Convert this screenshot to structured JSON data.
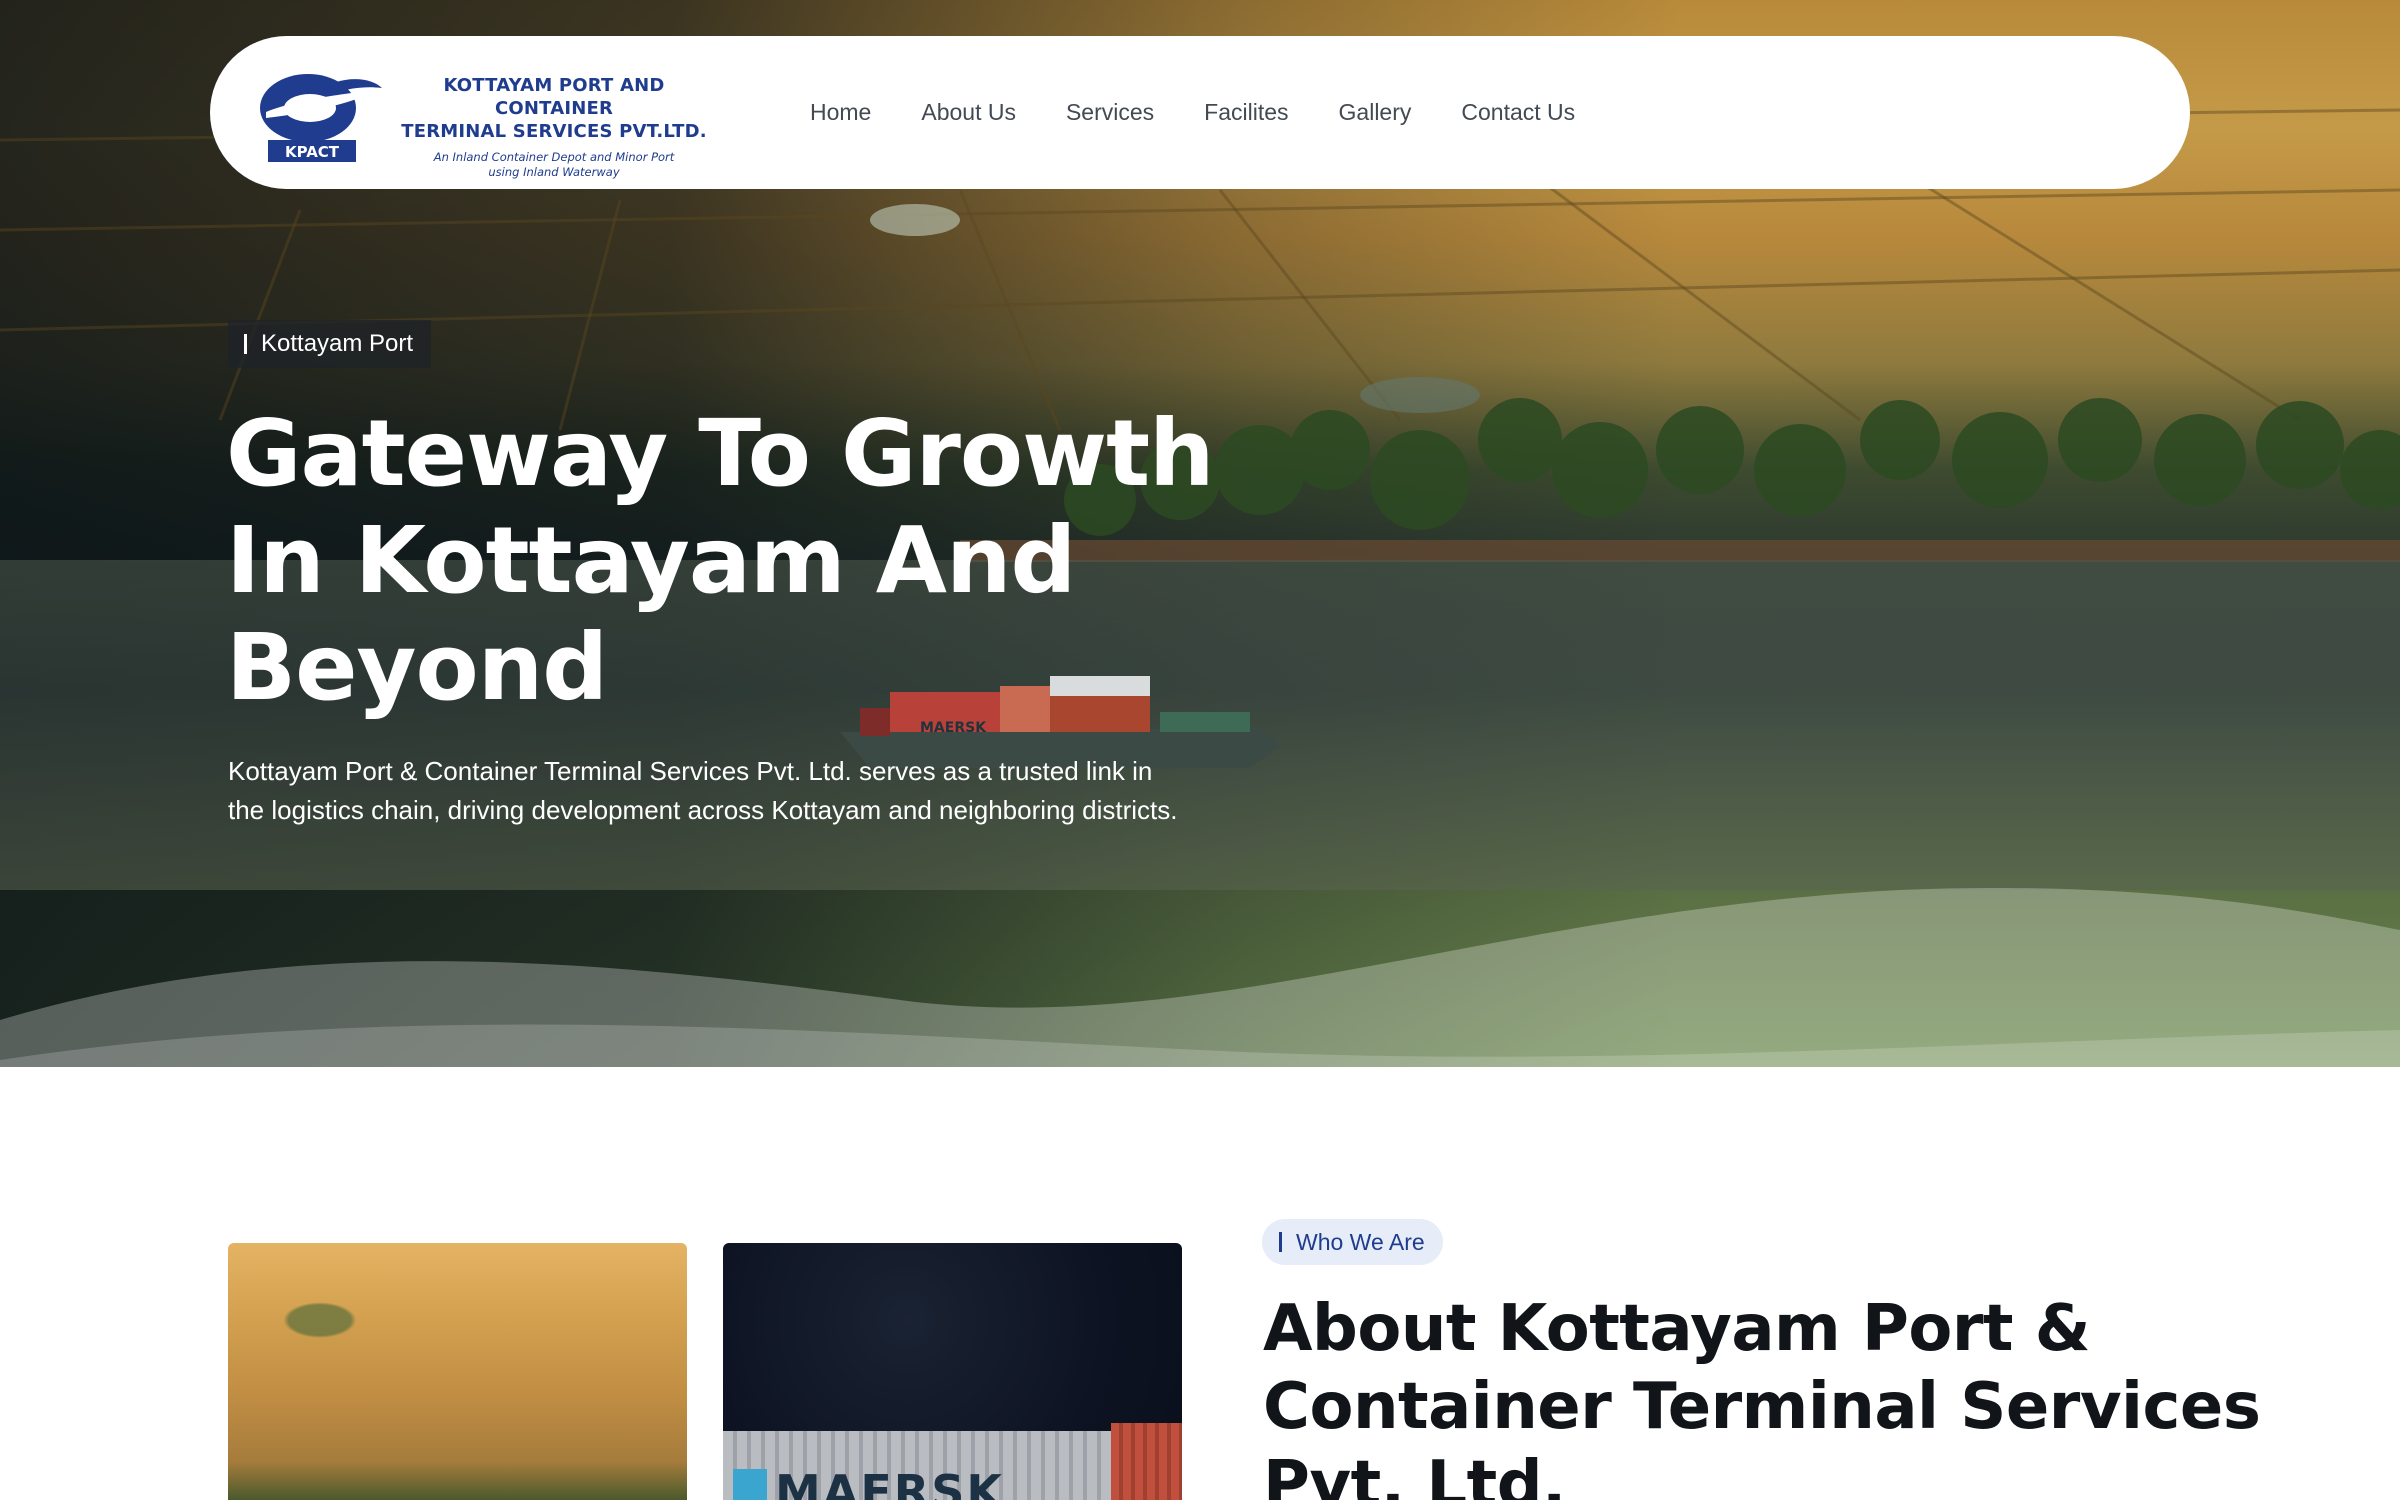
{
  "header": {
    "logo": {
      "badge": "KPACT",
      "title_line1": "KOTTAYAM PORT AND CONTAINER",
      "title_line2": "TERMINAL SERVICES PVT.LTD.",
      "subtitle_line1": "An Inland Container Depot and Minor Port",
      "subtitle_line2": "using Inland Waterway",
      "icon": "kpact-logo-icon"
    },
    "nav": [
      {
        "label": "Home"
      },
      {
        "label": "About Us"
      },
      {
        "label": "Services"
      },
      {
        "label": "Facilites"
      },
      {
        "label": "Gallery"
      },
      {
        "label": "Contact Us"
      }
    ]
  },
  "hero": {
    "tag": "Kottayam Port",
    "title": "Gateway To Growth In Kottayam And Beyond",
    "description": "Kottayam Port & Container Terminal Services Pvt. Ltd. serves as a trusted link in the logistics chain, driving development across Kottayam and neighboring districts.",
    "ship_label": "MAERSK"
  },
  "about": {
    "tag": "Who We Are",
    "title": "About Kottayam Port & Container Terminal Services Pvt. Ltd.",
    "image_container_text": "MAERSK"
  },
  "colors": {
    "brand_blue": "#1f3c8f",
    "tag_bg": "#e6edf8",
    "text_dark": "#111418"
  }
}
